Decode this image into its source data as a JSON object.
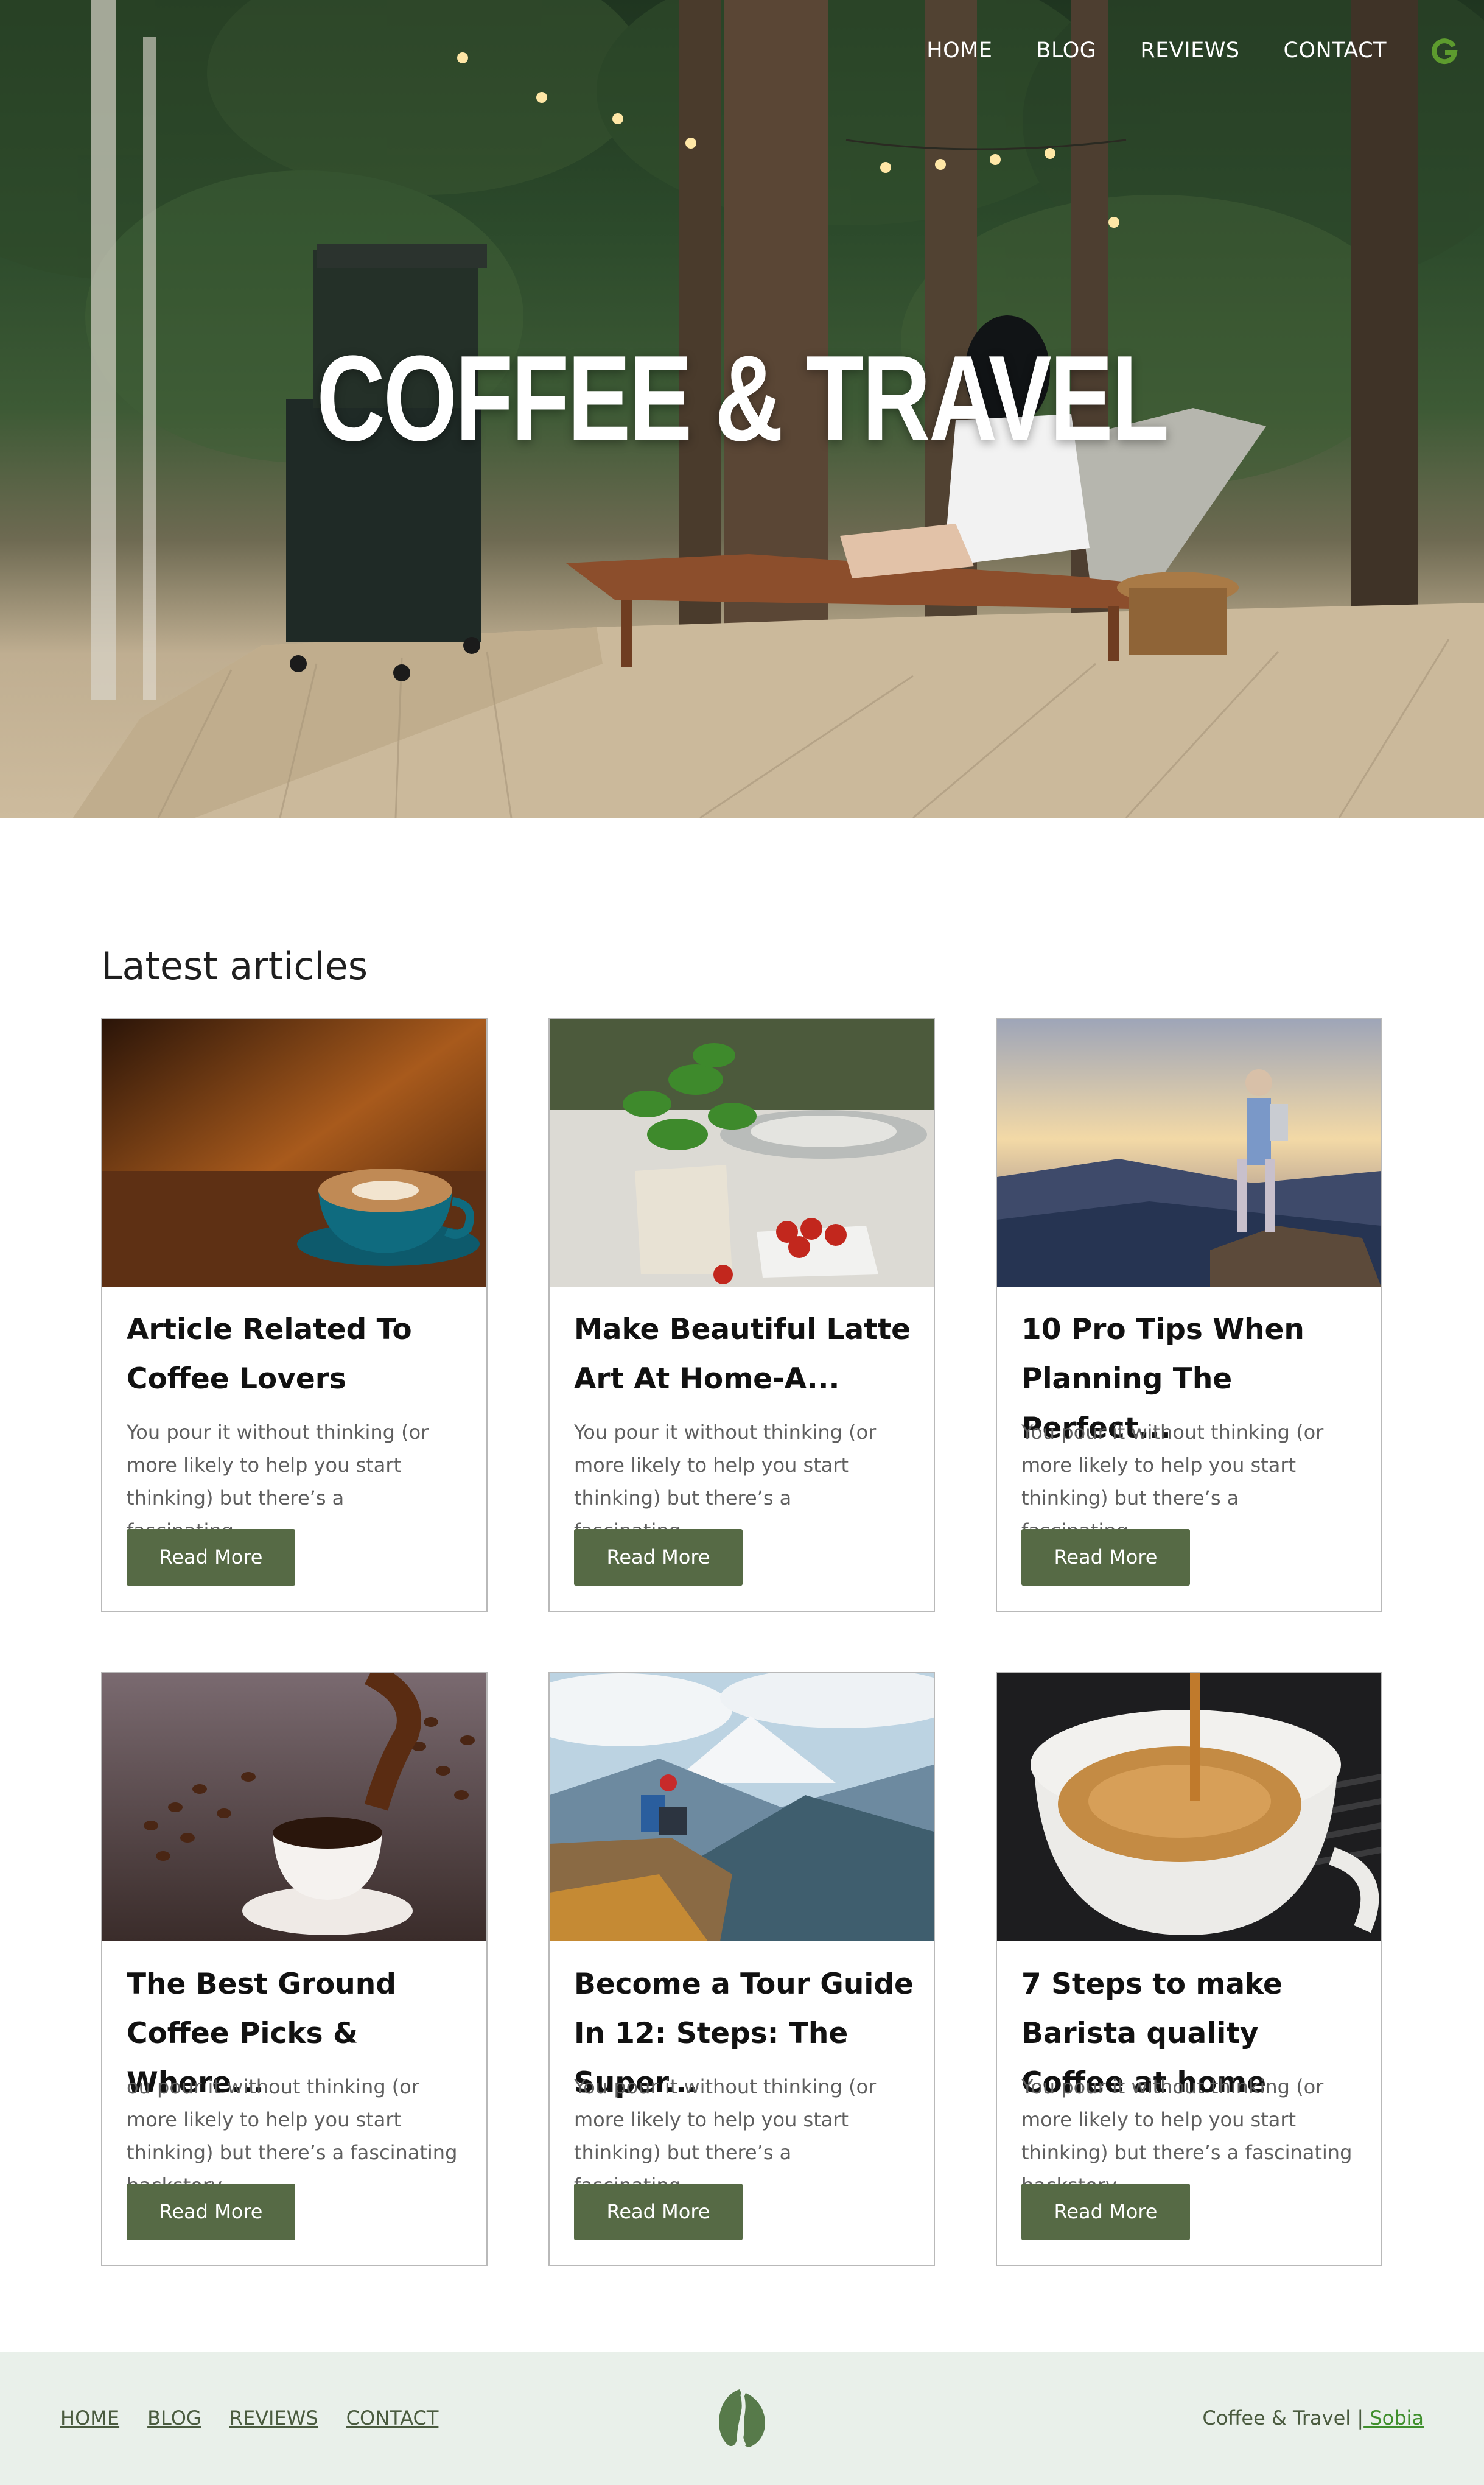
{
  "nav": {
    "items": [
      {
        "label": "HOME"
      },
      {
        "label": "BLOG"
      },
      {
        "label": "REVIEWS"
      },
      {
        "label": "CONTACT"
      }
    ],
    "logo_icon": "g-logo-icon",
    "logo_color": "#5d9b2e"
  },
  "hero": {
    "title": "COFFEE & TRAVEL"
  },
  "latest": {
    "heading": "Latest articles",
    "button_label": "Read More",
    "button_color": "#566a45",
    "articles": [
      {
        "title": "Article Related To Coffee Lovers",
        "excerpt": "You pour it without thinking (or more likely to help you start thinking) but there’s a fascinating...",
        "image": "latte-art-cup"
      },
      {
        "title": "Make Beautiful Latte Art At Home-A...",
        "excerpt": "You pour it without thinking (or more likely to help you start thinking) but there’s a fascinating...",
        "image": "table-with-basil-and-strawberries"
      },
      {
        "title": "10 Pro Tips When Planning The Perfect...",
        "excerpt": "You pour it without thinking (or more likely to help you start thinking) but there’s a fascinating...",
        "image": "hiker-at-sunset"
      },
      {
        "title": "The Best Ground Coffee Picks & Where...",
        "excerpt": "ou pour it without thinking (or more likely to help you start thinking) but there’s a fascinating backstory...",
        "image": "coffee-beans-and-cup"
      },
      {
        "title": "Become a Tour Guide In 12: Steps: The Super...",
        "excerpt": "You pour it without thinking (or more likely to help you start thinking) but there’s a fascinating...",
        "image": "mountain-valley-hiker"
      },
      {
        "title": "7 Steps to make Barista quality Coffee at home",
        "excerpt": "You pour it without thinking (or more likely to help you start thinking) but there’s a fascinating backstory...",
        "image": "espresso-pour"
      }
    ]
  },
  "footer": {
    "links": [
      {
        "label": "HOME"
      },
      {
        "label": "BLOG"
      },
      {
        "label": "REVIEWS"
      },
      {
        "label": "CONTACT"
      }
    ],
    "logo_icon": "coffee-bean-leaf-icon",
    "credit_text": "Coffee & Travel |",
    "credit_author": " Sobia",
    "background": "#e9f0ea"
  }
}
